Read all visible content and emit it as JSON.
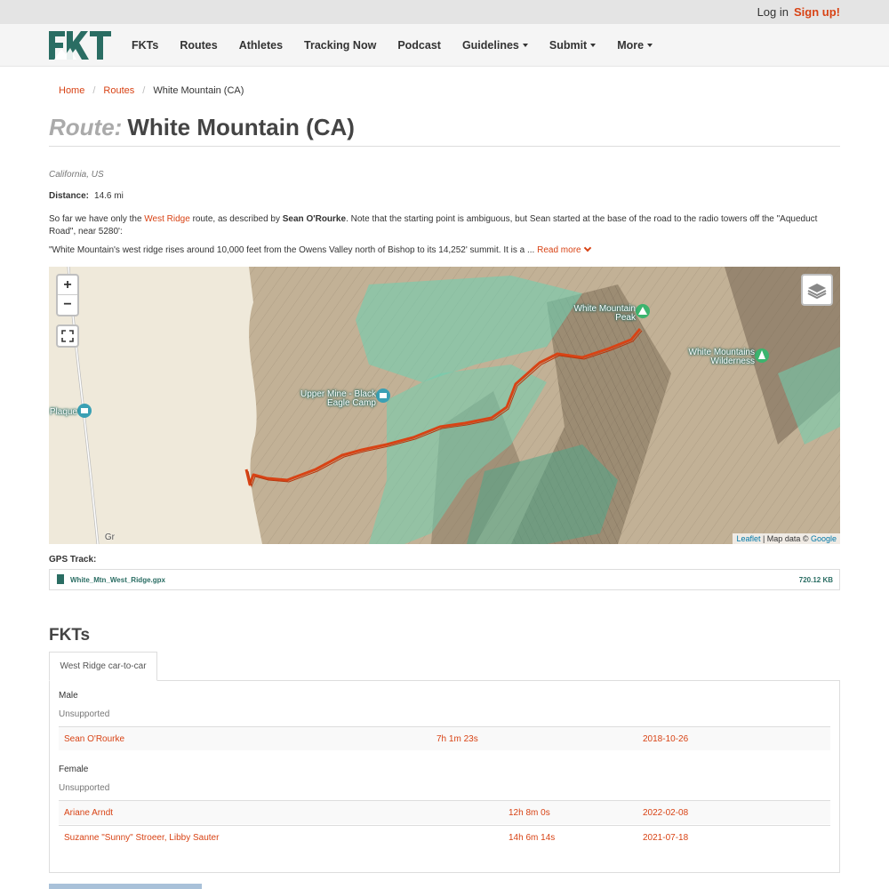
{
  "topbar": {
    "login": "Log in",
    "signup": "Sign up!"
  },
  "brand": {
    "logo_text": "FKT",
    "accent": "#2a6d63",
    "link_color": "#d84315"
  },
  "nav": {
    "items": [
      {
        "label": "FKTs",
        "dropdown": false
      },
      {
        "label": "Routes",
        "dropdown": false
      },
      {
        "label": "Athletes",
        "dropdown": false
      },
      {
        "label": "Tracking Now",
        "dropdown": false
      },
      {
        "label": "Podcast",
        "dropdown": false
      },
      {
        "label": "Guidelines",
        "dropdown": true
      },
      {
        "label": "Submit",
        "dropdown": true
      },
      {
        "label": "More",
        "dropdown": true
      }
    ]
  },
  "breadcrumb": {
    "home": "Home",
    "routes": "Routes",
    "current": "White Mountain (CA)"
  },
  "route": {
    "label": "Route:",
    "name": "White Mountain (CA)",
    "location": "California, US",
    "distance_label": "Distance:",
    "distance_value": "14.6 mi",
    "desc_part1": "So far we have only the ",
    "desc_link": "West Ridge",
    "desc_part2": " route, as described by ",
    "desc_bold": "Sean O'Rourke",
    "desc_part3": ".  Note that the starting point is ambiguous, but Sean started at the base of the road to the radio towers off the \"Aqueduct Road\", near 5280':",
    "quote": "\"White Mountain's west ridge rises around 10,000 feet from the Owens Valley north of Bishop to its 14,252' summit. It is a ... ",
    "read_more": "Read more"
  },
  "map": {
    "zoom_in": "+",
    "zoom_out": "−",
    "labels": {
      "peak": "White Mountain Peak",
      "wilderness": "White Mountains Wilderness",
      "camp": "Upper Mine - Black Eagle Camp",
      "plaque": "Plaque",
      "road": "Gr"
    },
    "attribution": {
      "leaflet": "Leaflet",
      "mid": " | Map data © ",
      "google": "Google"
    },
    "colors": {
      "track": "#d84315",
      "green": "#6fcfb0",
      "terrain": "#c8b9a0"
    }
  },
  "gps": {
    "label": "GPS Track:",
    "filename": "White_Mtn_West_Ridge.gpx",
    "filesize": "720.12 KB"
  },
  "fkts": {
    "heading": "FKTs",
    "tab": "West Ridge car-to-car",
    "male": {
      "label": "Male",
      "style": "Unsupported",
      "rows": [
        {
          "name": "Sean O'Rourke",
          "time": "7h 1m 23s",
          "date": "2018-10-26"
        }
      ]
    },
    "female": {
      "label": "Female",
      "style": "Unsupported",
      "rows": [
        {
          "name": "Ariane Arndt",
          "time": "12h 8m 0s",
          "date": "2022-02-08"
        },
        {
          "name": "Suzanne \"Sunny\" Stroeer, Libby Sauter",
          "time": "14h 6m 14s",
          "date": "2021-07-18"
        }
      ]
    }
  }
}
